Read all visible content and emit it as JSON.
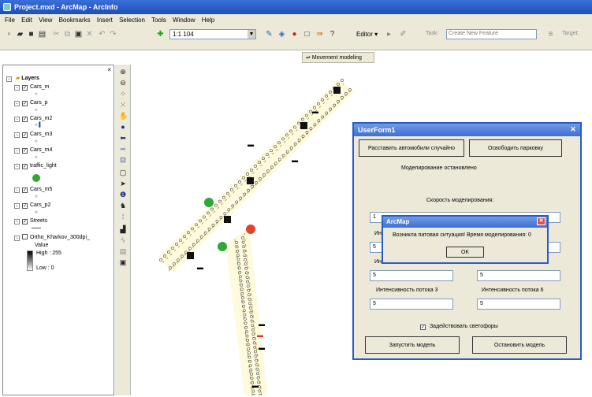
{
  "window": {
    "title": "Project.mxd - ArcMap - ArcInfo"
  },
  "menu": [
    "File",
    "Edit",
    "View",
    "Bookmarks",
    "Insert",
    "Selection",
    "Tools",
    "Window",
    "Help"
  ],
  "toolbar": {
    "scale": "1:1 104",
    "editor_label": "Editor ▾",
    "task_label": "Task:",
    "task_value": "Create New Feature",
    "target_label": "Target:"
  },
  "movement_button": "Movement modeling",
  "toc": {
    "root": "Layers",
    "layers": [
      "Cars_m",
      "Cars_p",
      "Cars_m2",
      "Cars_m3",
      "Cars_m4",
      "traffic_light",
      "Cars_m5",
      "Cars_p2",
      "Streets",
      "Ortho_Kharkov_300dpi_"
    ],
    "raster_value_label": "Value",
    "raster_high": "High : 255",
    "raster_low": "Low : 0"
  },
  "userform": {
    "title": "UserForm1",
    "place_cars_button": "Расставить автомобили случайно",
    "free_parking_button": "Освободить парковку",
    "status_text": "Моделирование остановлено",
    "speed_label": "Скорость моделирования:",
    "speed_value": "1",
    "flow_label_partial_1": "Ин",
    "flow_value_1": "5",
    "flow_label_partial_2": "Ин",
    "flow_value_5": "5",
    "flow_value_3a": "5",
    "flow_value_3b": "5",
    "flow3_label": "Интенсивность потока 3",
    "flow6_label": "Интенсивность потока 6",
    "flow3_value": "5",
    "flow6_value": "5",
    "traffic_lights_checkbox": "Задействовать светофоры",
    "start_button": "Запустить модель",
    "stop_button": "Остановить модель"
  },
  "message": {
    "title": "ArcMap",
    "text": "Возникла патовая ситуация! Время моделирования: 0",
    "ok": "OK"
  },
  "colors": {
    "title_blue": "#2a5cc8",
    "light_green": "#2fa83a",
    "light_red": "#e0442e"
  }
}
